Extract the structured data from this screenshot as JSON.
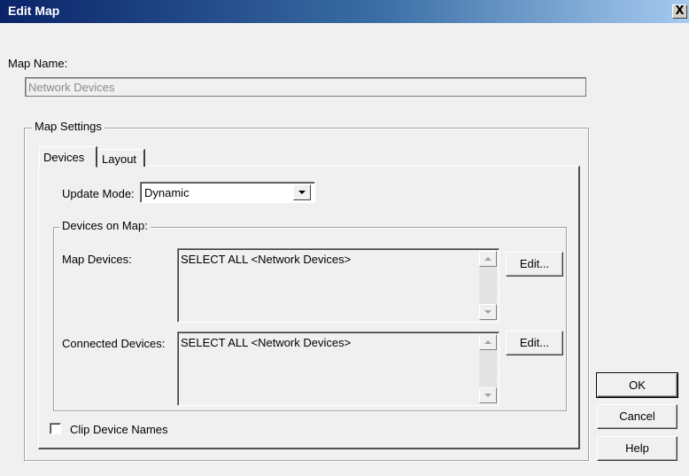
{
  "window": {
    "title": "Edit Map",
    "close_glyph": "X"
  },
  "map_name": {
    "label": "Map Name:",
    "value": "Network Devices"
  },
  "map_settings": {
    "group_label": "Map Settings",
    "tabs": [
      {
        "label": "Devices",
        "selected": true
      },
      {
        "label": "Layout",
        "selected": false
      }
    ],
    "update_mode": {
      "label": "Update Mode:",
      "value": "Dynamic"
    },
    "devices_on_map": {
      "group_label": "Devices on Map:",
      "map_devices": {
        "label": "Map Devices:",
        "value": "SELECT ALL <Network Devices>",
        "edit_label": "Edit..."
      },
      "connected_devices": {
        "label": "Connected Devices:",
        "value": "SELECT ALL <Network Devices>",
        "edit_label": "Edit..."
      }
    },
    "clip_device_names": {
      "label": "Clip Device Names",
      "checked": false
    }
  },
  "buttons": {
    "ok": "OK",
    "cancel": "Cancel",
    "help": "Help"
  },
  "colors": {
    "title_bar_start": "#0a246a",
    "title_bar_end": "#a6caf0",
    "dialog_bg": "#f0f0f0"
  },
  "icons": {
    "close": "close-icon",
    "dropdown": "chevron-down-icon",
    "scroll_up": "scroll-up-arrow-icon",
    "scroll_down": "scroll-down-arrow-icon"
  }
}
